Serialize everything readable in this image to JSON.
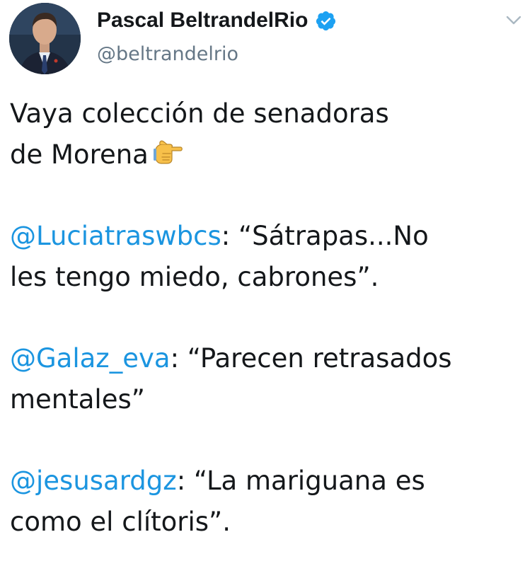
{
  "author": {
    "display_name": "Pascal BeltrandelRio",
    "handle": "@beltrandelrio",
    "verified": true,
    "avatar": "profile-photo"
  },
  "menu": {
    "icon": "chevron-down-icon"
  },
  "tweet": {
    "line1": "Vaya colección de senadoras",
    "line2": "de Morena",
    "emoji": "backhand-index-pointing-right",
    "quote1": {
      "mention": "@Luciatraswbcs",
      "text_a": ": “Sátrapas...No",
      "text_b": "les tengo miedo, cabrones”."
    },
    "quote2": {
      "mention": "@Galaz_eva",
      "text_a": ": “Parecen retrasados",
      "text_b": "mentales”"
    },
    "quote3": {
      "mention": "@jesusardgz",
      "text_a": ": “La mariguana es",
      "text_b": "como el clítoris”."
    }
  },
  "colors": {
    "text": "#14171a",
    "secondary": "#657786",
    "link": "#1b95e0",
    "verified": "#1da1f2"
  }
}
